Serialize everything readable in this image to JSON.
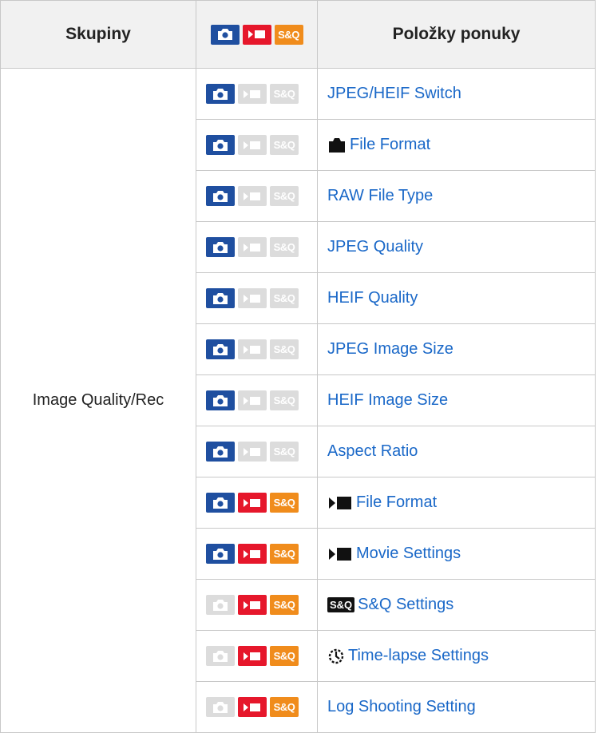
{
  "headers": {
    "group": "Skupiny",
    "menu_items": "Položky ponuky",
    "mode_icons": [
      "still-camera-icon",
      "movie-icon",
      "sq-icon"
    ],
    "sq_label": "S&Q"
  },
  "group": {
    "label": "Image Quality/Rec"
  },
  "colors": {
    "still_on": "#1f4fa0",
    "movie_on": "#e6172b",
    "sq_on": "#f08c1c",
    "disabled": "#dcdcdc",
    "link": "#1a68c8"
  },
  "rows": [
    {
      "still": true,
      "movie": false,
      "sq": false,
      "prefix_icon": null,
      "label": "JPEG/HEIF Switch"
    },
    {
      "still": true,
      "movie": false,
      "sq": false,
      "prefix_icon": "still-camera-icon",
      "label": "File Format"
    },
    {
      "still": true,
      "movie": false,
      "sq": false,
      "prefix_icon": null,
      "label": "RAW File Type"
    },
    {
      "still": true,
      "movie": false,
      "sq": false,
      "prefix_icon": null,
      "label": "JPEG Quality"
    },
    {
      "still": true,
      "movie": false,
      "sq": false,
      "prefix_icon": null,
      "label": "HEIF Quality"
    },
    {
      "still": true,
      "movie": false,
      "sq": false,
      "prefix_icon": null,
      "label": "JPEG Image Size"
    },
    {
      "still": true,
      "movie": false,
      "sq": false,
      "prefix_icon": null,
      "label": "HEIF Image Size"
    },
    {
      "still": true,
      "movie": false,
      "sq": false,
      "prefix_icon": null,
      "label": "Aspect Ratio"
    },
    {
      "still": true,
      "movie": true,
      "sq": true,
      "prefix_icon": "movie-icon",
      "label": "File Format"
    },
    {
      "still": true,
      "movie": true,
      "sq": true,
      "prefix_icon": "movie-icon",
      "label": "Movie Settings"
    },
    {
      "still": false,
      "movie": true,
      "sq": true,
      "prefix_icon": "sq-icon",
      "label": "S&Q Settings"
    },
    {
      "still": false,
      "movie": true,
      "sq": true,
      "prefix_icon": "timelapse-icon",
      "label": "Time-lapse Settings"
    },
    {
      "still": false,
      "movie": true,
      "sq": true,
      "prefix_icon": null,
      "label": "Log Shooting Setting"
    }
  ]
}
